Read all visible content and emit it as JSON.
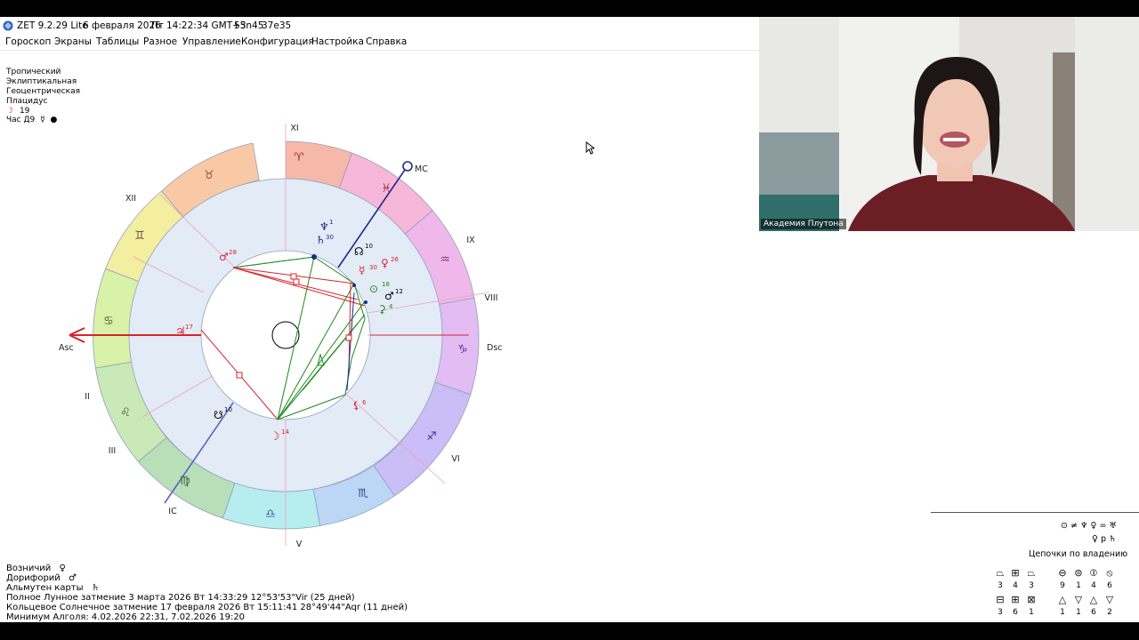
{
  "titlebar": {
    "app_name": "ZET 9.2.29 Lite",
    "date": "6 февраля 2026",
    "weekday": "Пт",
    "time": "14:22:34 GMT+3",
    "lat": "55n45",
    "lon": "37e35"
  },
  "menu": [
    "Гороскоп",
    "Экраны",
    "Таблицы",
    "Разное",
    "Управление",
    "Конфигурация",
    "Настройка",
    "Справка"
  ],
  "settings": {
    "zodiac": "Тропический",
    "coords": "Эклиптикальная",
    "center": "Геоцентрическая",
    "houses": "Плацидус",
    "moon_day": "19",
    "hour_label": "Час Д9"
  },
  "chart": {
    "houses": [
      "XI",
      "XII",
      "IX",
      "VIII",
      "II",
      "III",
      "VI",
      "IC",
      "V"
    ],
    "axes": {
      "asc": "Asc",
      "dsc": "Dsc",
      "mc": "MC",
      "ic": "IC"
    },
    "planet_degrees": {
      "neptune": "1",
      "saturn": "30",
      "node_top": "10",
      "mars_fixed": "28",
      "mercury": "30",
      "venus": "26",
      "sun": "18",
      "mars": "12",
      "ceres": "4",
      "jupiter": "17",
      "lilith": "6",
      "node_bottom": "10",
      "moon": "14"
    },
    "colors": {
      "fire": "#f6b8a8",
      "earth": "#f9c9a6",
      "air": "#f4eea0",
      "water": "#c9eab6",
      "inner": "#dfe8f4",
      "accent_red": "#d8232a",
      "accent_green": "#1a8a1a",
      "accent_blue": "#1b2a8a"
    }
  },
  "bottom": {
    "voznichiy_label": "Возничий",
    "doriforiy_label": "Дорифорий",
    "almuten_label": "Альмутен карты",
    "lunar_eclipse": "Полное Лунное затмение 3 марта 2026 Вт 14:33:29 12°53'53\"Vir (25 дней)",
    "solar_eclipse": "Кольцевое Солнечное затмение 17 февраля 2026 Вт 15:11:41 28°49'44\"Aqr (11 дней)",
    "algol": "Минимум Алголя: 4.02.2026 22:31,  7.02.2026 19:20"
  },
  "video": {
    "caption": "Академия Плутона"
  },
  "chains": {
    "title": "Цепочки по владению",
    "row1": "⊙ ≠ ♆ ♀ = ♅",
    "row2": "♀ p ♄"
  },
  "figures": {
    "row1_nums": [
      "3",
      "4",
      "3",
      "9",
      "1",
      "4",
      "6"
    ],
    "row2_nums": [
      "3",
      "6",
      "1",
      "1",
      "1",
      "6",
      "2"
    ]
  }
}
